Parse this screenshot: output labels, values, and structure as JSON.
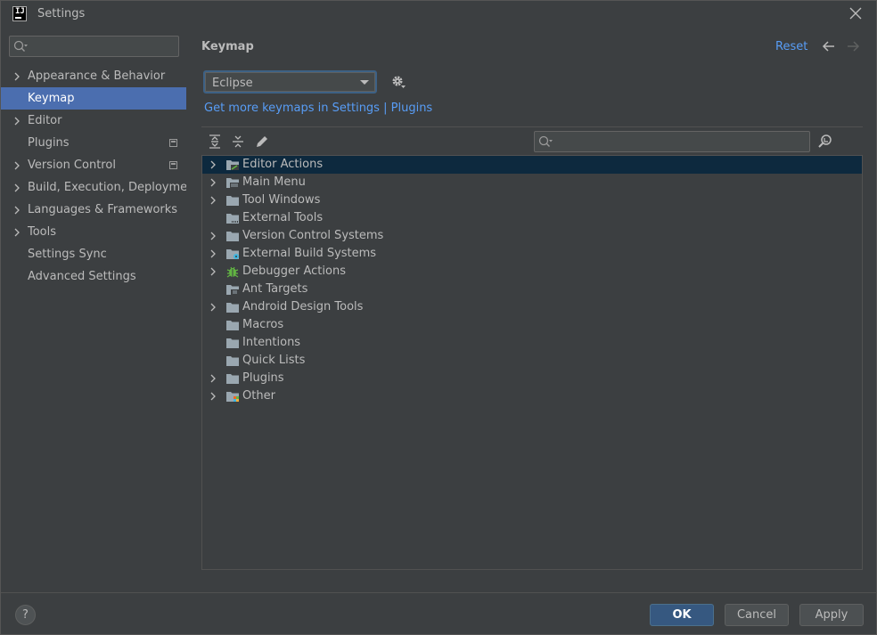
{
  "window": {
    "title": "Settings",
    "app_icon": "IJ"
  },
  "sidebar": {
    "search_placeholder": "",
    "items": [
      {
        "label": "Appearance & Behavior",
        "expandable": true,
        "project_icon": false,
        "selected": false
      },
      {
        "label": "Keymap",
        "expandable": false,
        "project_icon": false,
        "selected": true
      },
      {
        "label": "Editor",
        "expandable": true,
        "project_icon": false,
        "selected": false
      },
      {
        "label": "Plugins",
        "expandable": false,
        "project_icon": true,
        "selected": false
      },
      {
        "label": "Version Control",
        "expandable": true,
        "project_icon": true,
        "selected": false
      },
      {
        "label": "Build, Execution, Deployment",
        "expandable": true,
        "project_icon": false,
        "selected": false
      },
      {
        "label": "Languages & Frameworks",
        "expandable": true,
        "project_icon": false,
        "selected": false
      },
      {
        "label": "Tools",
        "expandable": true,
        "project_icon": false,
        "selected": false
      },
      {
        "label": "Settings Sync",
        "expandable": false,
        "project_icon": false,
        "selected": false
      },
      {
        "label": "Advanced Settings",
        "expandable": false,
        "project_icon": false,
        "selected": false
      }
    ]
  },
  "main": {
    "title": "Keymap",
    "reset_label": "Reset",
    "keymap_select": {
      "value": "Eclipse"
    },
    "more_link_prefix": "Get more keymaps in Settings",
    "more_link_sep": "|",
    "more_link_plugins": "Plugins",
    "tree_search_placeholder": "",
    "tree": [
      {
        "label": "Editor Actions",
        "expandable": true,
        "icon": "editor-actions-icon",
        "selected": true
      },
      {
        "label": "Main Menu",
        "expandable": true,
        "icon": "main-menu-icon",
        "selected": false
      },
      {
        "label": "Tool Windows",
        "expandable": true,
        "icon": "folder-icon",
        "selected": false
      },
      {
        "label": "External Tools",
        "expandable": false,
        "icon": "external-tools-icon",
        "selected": false
      },
      {
        "label": "Version Control Systems",
        "expandable": true,
        "icon": "folder-icon",
        "selected": false
      },
      {
        "label": "External Build Systems",
        "expandable": true,
        "icon": "build-systems-icon",
        "selected": false
      },
      {
        "label": "Debugger Actions",
        "expandable": true,
        "icon": "bug-icon",
        "selected": false
      },
      {
        "label": "Ant Targets",
        "expandable": false,
        "icon": "ant-targets-icon",
        "selected": false
      },
      {
        "label": "Android Design Tools",
        "expandable": true,
        "icon": "folder-icon",
        "selected": false
      },
      {
        "label": "Macros",
        "expandable": false,
        "icon": "folder-icon",
        "selected": false
      },
      {
        "label": "Intentions",
        "expandable": false,
        "icon": "folder-icon",
        "selected": false
      },
      {
        "label": "Quick Lists",
        "expandable": false,
        "icon": "folder-icon",
        "selected": false
      },
      {
        "label": "Plugins",
        "expandable": true,
        "icon": "folder-icon",
        "selected": false
      },
      {
        "label": "Other",
        "expandable": true,
        "icon": "other-icon",
        "selected": false
      }
    ]
  },
  "footer": {
    "help_label": "?",
    "ok_label": "OK",
    "cancel_label": "Cancel",
    "apply_label": "Apply"
  },
  "colors": {
    "background": "#3c3f41",
    "selection": "#4b6eaf",
    "tree_selection": "#0d293e",
    "link": "#589df6",
    "primary_button": "#365880"
  }
}
